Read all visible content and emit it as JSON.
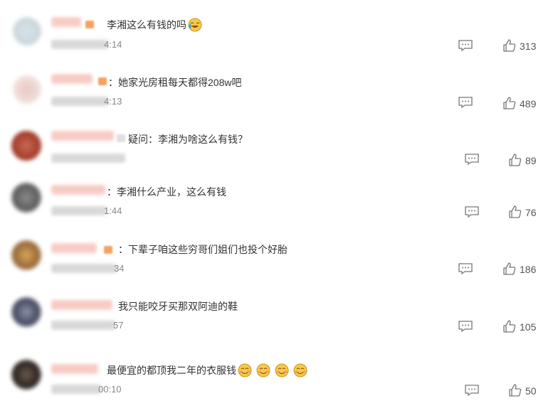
{
  "comments": [
    {
      "text": "李湘这么有钱的吗",
      "time": "4:14",
      "likes": "313",
      "emojis": [
        "laugh-cry-emoji"
      ]
    },
    {
      "text": "：她家光房租每天都得208w吧",
      "time": "4:13",
      "likes": "489",
      "emojis": []
    },
    {
      "text": "疑问：李湘为啥这么有钱？",
      "time": "",
      "likes": "89",
      "emojis": []
    },
    {
      "text": "：李湘什么产业，这么有钱",
      "time": "1:44",
      "likes": "76",
      "emojis": []
    },
    {
      "text": "：下辈子咱这些穷哥们姐们也投个好胎",
      "time": "34",
      "likes": "186",
      "emojis": []
    },
    {
      "text": "我只能咬牙买那双阿迪的鞋",
      "time": "57",
      "likes": "105",
      "emojis": []
    },
    {
      "text": "最便宜的都顶我二年的衣服钱",
      "time": "00:10",
      "likes": "50",
      "emojis": [
        "smile-emoji",
        "smile-emoji",
        "smile-emoji",
        "smile-emoji"
      ]
    }
  ],
  "colors": {
    "blurred_name": "#f4b8b0",
    "emoji": "#f6c94a"
  },
  "icons": {
    "reply": "comment-icon",
    "like": "thumbs-up-icon"
  }
}
